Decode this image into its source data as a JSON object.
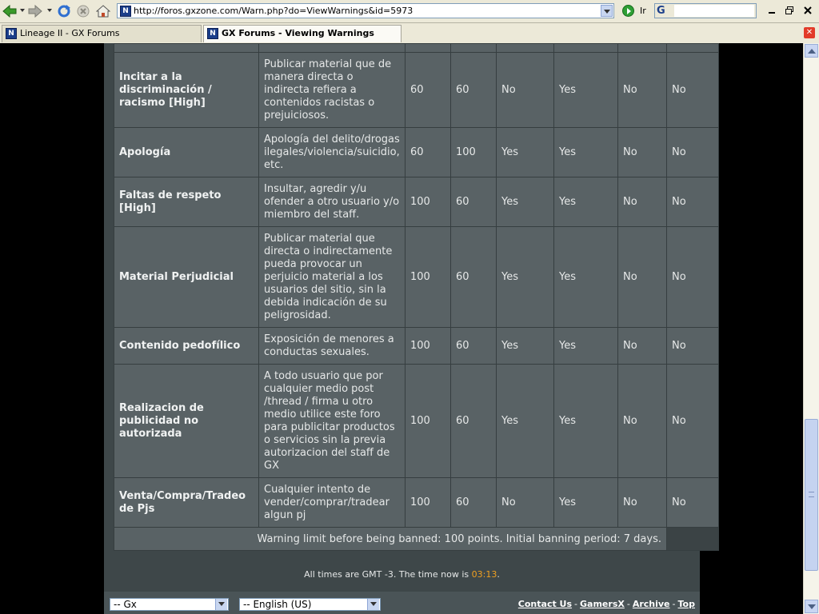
{
  "browser": {
    "address": "http://foros.gxzone.com/Warn.php?do=ViewWarnings&id=5973",
    "go_label": "Ir",
    "search_engine_icon": "G",
    "favicon_glyph": "N",
    "tabs": [
      {
        "label": "Lineage II - GX Forums",
        "active": false
      },
      {
        "label": "GX Forums - Viewing Warnings",
        "active": true
      }
    ]
  },
  "warnings": {
    "rows": [
      {
        "name": "",
        "desc": "",
        "c1": "",
        "c2": "",
        "c3": "",
        "c4": "",
        "c5": "",
        "c6": ""
      },
      {
        "name": "Incitar a la discriminación / racismo [High]",
        "desc": "Publicar material que de manera directa o indirecta refiera a contenidos racistas o prejuiciosos.",
        "c1": "60",
        "c2": "60",
        "c3": "No",
        "c4": "Yes",
        "c5": "No",
        "c6": "No"
      },
      {
        "name": "Apología",
        "desc": "Apología del delito/drogas ilegales/violencia/suicidio, etc.",
        "c1": "60",
        "c2": "100",
        "c3": "Yes",
        "c4": "Yes",
        "c5": "No",
        "c6": "No"
      },
      {
        "name": "Faltas de respeto [High]",
        "desc": "Insultar, agredir y/u ofender a otro usuario y/o miembro del staff.",
        "c1": "100",
        "c2": "60",
        "c3": "Yes",
        "c4": "Yes",
        "c5": "No",
        "c6": "No"
      },
      {
        "name": "Material Perjudicial",
        "desc": "Publicar material que directa o indirectamente pueda provocar un perjuicio material a los usuarios del sitio, sin la debida indicación de su peligrosidad.",
        "c1": "100",
        "c2": "60",
        "c3": "Yes",
        "c4": "Yes",
        "c5": "No",
        "c6": "No"
      },
      {
        "name": "Contenido pedofílico",
        "desc": "Exposición de menores a conductas sexuales.",
        "c1": "100",
        "c2": "60",
        "c3": "Yes",
        "c4": "Yes",
        "c5": "No",
        "c6": "No"
      },
      {
        "name": "Realizacion de publicidad no autorizada",
        "desc": "A todo usuario que por cualquier medio post /thread / firma u otro medio utilice este foro para publicitar productos o servicios sin la previa autorizacion del staff de GX",
        "c1": "100",
        "c2": "60",
        "c3": "Yes",
        "c4": "Yes",
        "c5": "No",
        "c6": "No"
      },
      {
        "name": "Venta/Compra/Tradeo de Pjs",
        "desc": "Cualquier intento de vender/comprar/tradear algun pj",
        "c1": "100",
        "c2": "60",
        "c3": "No",
        "c4": "Yes",
        "c5": "No",
        "c6": "No"
      }
    ],
    "limit_text": "Warning limit before being banned: 100 points. Initial banning period: 7 days."
  },
  "footer": {
    "time_prefix": "All times are GMT -3. The time now is ",
    "time_value": "03:13",
    "time_suffix": ".",
    "style_select": "-- Gx",
    "language_select": "-- English (US)",
    "links": [
      "Contact Us",
      "GamersX",
      "Archive",
      "Top"
    ]
  },
  "icons": {
    "back": "back-arrow-icon",
    "forward": "forward-arrow-icon",
    "reload": "reload-icon",
    "stop": "stop-icon",
    "home": "home-icon",
    "go": "go-arrow-icon",
    "close_tab": "close-tab-icon"
  }
}
